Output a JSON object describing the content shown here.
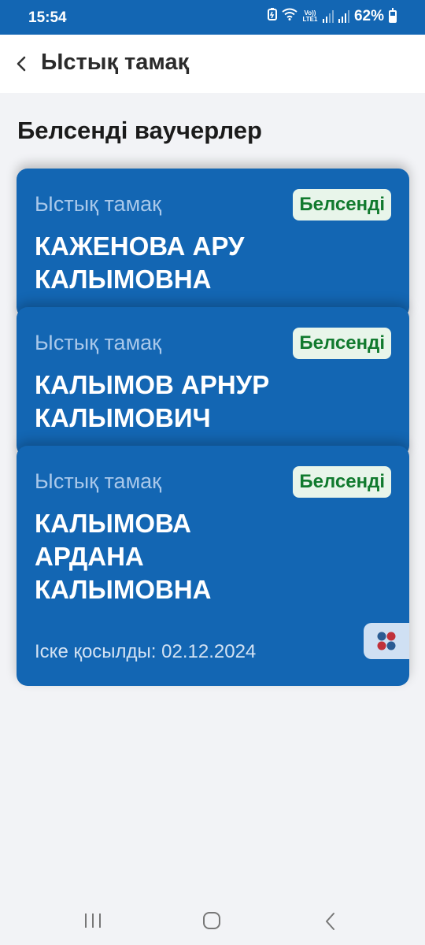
{
  "status_bar": {
    "time": "15:54",
    "volte_label": "Vo)) LTE1",
    "battery_percent": "62%",
    "battery_level": 0.62
  },
  "header": {
    "title": "Ыстық тамақ"
  },
  "section": {
    "title": "Белсенді ваучерлер"
  },
  "vouchers": [
    {
      "type": "Ыстық тамақ",
      "badge": "Белсенді",
      "name": "КАЖЕНОВА АРУ КАЛЫМОВНА"
    },
    {
      "type": "Ыстық тамақ",
      "badge": "Белсенді",
      "name": "КАЛЫМОВ АРНУР КАЛЫМОВИЧ"
    },
    {
      "type": "Ыстық тамақ",
      "badge": "Белсенді",
      "name": "КАЛЫМОВА АРДАНА КАЛЫМОВНА",
      "activated": "Іске қосылды: 02.12.2024"
    }
  ],
  "icons": {
    "back": "chevron-left-icon",
    "fab": "four-dots-icon",
    "nav_recents": "recents-icon",
    "nav_home": "home-icon",
    "nav_back": "back-icon"
  },
  "colors": {
    "brand_blue": "#1366b3",
    "badge_bg": "#e8f5ea",
    "badge_text": "#117a2e"
  }
}
